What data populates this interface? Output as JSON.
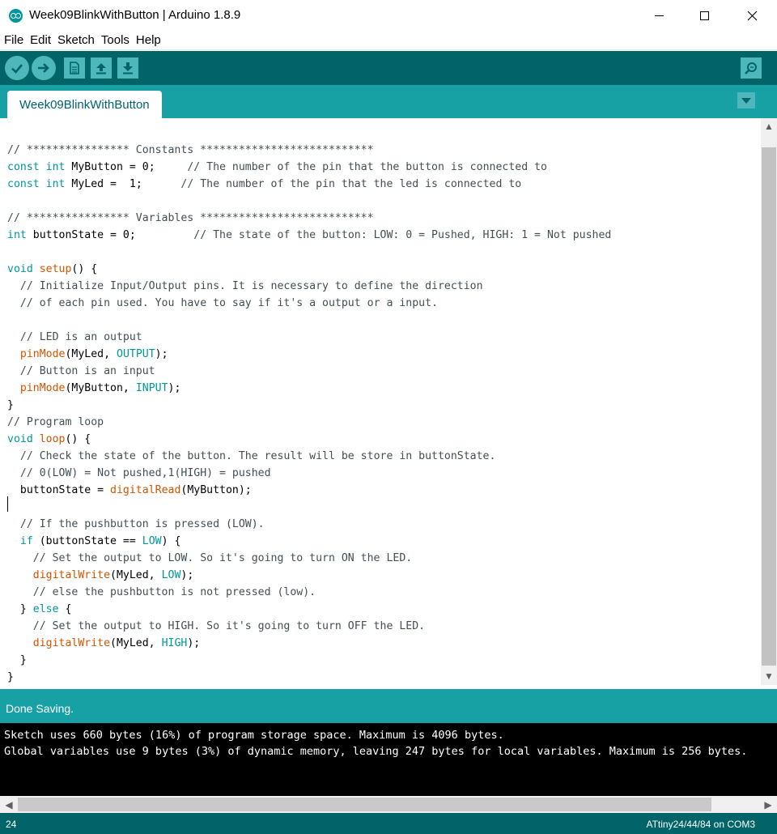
{
  "window": {
    "title": "Week09BlinkWithButton | Arduino 1.8.9",
    "controls": [
      "minimize",
      "maximize",
      "close"
    ]
  },
  "menu": [
    "File",
    "Edit",
    "Sketch",
    "Tools",
    "Help"
  ],
  "toolbar": {
    "buttons": [
      {
        "name": "verify",
        "icon": "checkmark-icon"
      },
      {
        "name": "upload",
        "icon": "arrow-right-icon"
      },
      {
        "name": "new",
        "icon": "document-icon"
      },
      {
        "name": "open",
        "icon": "arrow-up-icon"
      },
      {
        "name": "save",
        "icon": "arrow-down-icon"
      },
      {
        "name": "serial-monitor",
        "icon": "magnifier-icon"
      }
    ]
  },
  "tab": {
    "label": "Week09BlinkWithButton"
  },
  "editor": {
    "code": [
      [
        {
          "c": "cm",
          "t": "// **************** Constants ***************************"
        }
      ],
      [
        {
          "c": "kw",
          "t": "const"
        },
        {
          "t": " "
        },
        {
          "c": "kw",
          "t": "int"
        },
        {
          "t": " MyButton = 0;     "
        },
        {
          "c": "cm",
          "t": "// The number of the pin that the button is connected to"
        }
      ],
      [
        {
          "c": "kw",
          "t": "const"
        },
        {
          "t": " "
        },
        {
          "c": "kw",
          "t": "int"
        },
        {
          "t": " MyLed =  1;      "
        },
        {
          "c": "cm",
          "t": "// The number of the pin that the led is connected to"
        }
      ],
      [
        {
          "t": ""
        }
      ],
      [
        {
          "c": "cm",
          "t": "// **************** Variables ***************************"
        }
      ],
      [
        {
          "c": "kw",
          "t": "int"
        },
        {
          "t": " buttonState = 0;         "
        },
        {
          "c": "cm",
          "t": "// The state of the button: LOW: 0 = Pushed, HIGH: 1 = Not pushed"
        }
      ],
      [
        {
          "t": ""
        }
      ],
      [
        {
          "c": "kw",
          "t": "void"
        },
        {
          "t": " "
        },
        {
          "c": "fn",
          "t": "setup"
        },
        {
          "t": "() {"
        }
      ],
      [
        {
          "t": "  "
        },
        {
          "c": "cm",
          "t": "// Initialize Input/Output pins. It is necessary to define the direction"
        }
      ],
      [
        {
          "t": "  "
        },
        {
          "c": "cm",
          "t": "// of each pin used. You have to say if it's a output or a input."
        }
      ],
      [
        {
          "t": ""
        }
      ],
      [
        {
          "t": "  "
        },
        {
          "c": "cm",
          "t": "// LED is an output"
        }
      ],
      [
        {
          "t": "  "
        },
        {
          "c": "fn",
          "t": "pinMode"
        },
        {
          "t": "(MyLed, "
        },
        {
          "c": "kw",
          "t": "OUTPUT"
        },
        {
          "t": ");"
        }
      ],
      [
        {
          "t": "  "
        },
        {
          "c": "cm",
          "t": "// Button is an input"
        }
      ],
      [
        {
          "t": "  "
        },
        {
          "c": "fn",
          "t": "pinMode"
        },
        {
          "t": "(MyButton, "
        },
        {
          "c": "kw",
          "t": "INPUT"
        },
        {
          "t": ");"
        }
      ],
      [
        {
          "t": "}"
        }
      ],
      [
        {
          "c": "cm",
          "t": "// Program loop"
        }
      ],
      [
        {
          "c": "kw",
          "t": "void"
        },
        {
          "t": " "
        },
        {
          "c": "fn",
          "t": "loop"
        },
        {
          "t": "() {"
        }
      ],
      [
        {
          "t": "  "
        },
        {
          "c": "cm",
          "t": "// Check the state of the button. The result will be store in buttonState."
        }
      ],
      [
        {
          "t": "  "
        },
        {
          "c": "cm",
          "t": "// 0(LOW) = Not pushed,1(HIGH) = pushed"
        }
      ],
      [
        {
          "t": "  buttonState = "
        },
        {
          "c": "fn",
          "t": "digitalRead"
        },
        {
          "t": "(MyButton);"
        }
      ],
      [
        {
          "t": ""
        }
      ],
      [
        {
          "t": "  "
        },
        {
          "c": "cm",
          "t": "// If the pushbutton is pressed (LOW)."
        }
      ],
      [
        {
          "t": "  "
        },
        {
          "c": "kw",
          "t": "if"
        },
        {
          "t": " (buttonState == "
        },
        {
          "c": "kw",
          "t": "LOW"
        },
        {
          "t": ") {"
        }
      ],
      [
        {
          "t": "    "
        },
        {
          "c": "cm",
          "t": "// Set the output to LOW. So it's going to turn ON the LED."
        }
      ],
      [
        {
          "t": "    "
        },
        {
          "c": "fn",
          "t": "digitalWrite"
        },
        {
          "t": "(MyLed, "
        },
        {
          "c": "kw",
          "t": "LOW"
        },
        {
          "t": ");"
        }
      ],
      [
        {
          "t": "    "
        },
        {
          "c": "cm",
          "t": "// else the pushbutton is not pressed (low)."
        }
      ],
      [
        {
          "t": "  } "
        },
        {
          "c": "kw",
          "t": "else"
        },
        {
          "t": " {"
        }
      ],
      [
        {
          "t": "    "
        },
        {
          "c": "cm",
          "t": "// Set the output to HIGH. So it's going to turn OFF the LED."
        }
      ],
      [
        {
          "t": "    "
        },
        {
          "c": "fn",
          "t": "digitalWrite"
        },
        {
          "t": "(MyLed, "
        },
        {
          "c": "kw",
          "t": "HIGH"
        },
        {
          "t": ");"
        }
      ],
      [
        {
          "t": "  }"
        }
      ],
      [
        {
          "t": "}"
        }
      ]
    ]
  },
  "status": {
    "message": "Done Saving."
  },
  "console": {
    "lines": [
      "Sketch uses 660 bytes (16%) of program storage space. Maximum is 4096 bytes.",
      "Global variables use 9 bytes (3%) of dynamic memory, leaving 247 bytes for local variables. Maximum is 256 bytes."
    ]
  },
  "footer": {
    "line_number": "24",
    "board": "ATtiny24/44/84 on COM3"
  },
  "colors": {
    "toolbar": "#006468",
    "tabbar": "#17a1a5",
    "button": "#4db7bb",
    "keyword": "#00979c",
    "function": "#d35400",
    "comment": "#434f54"
  }
}
